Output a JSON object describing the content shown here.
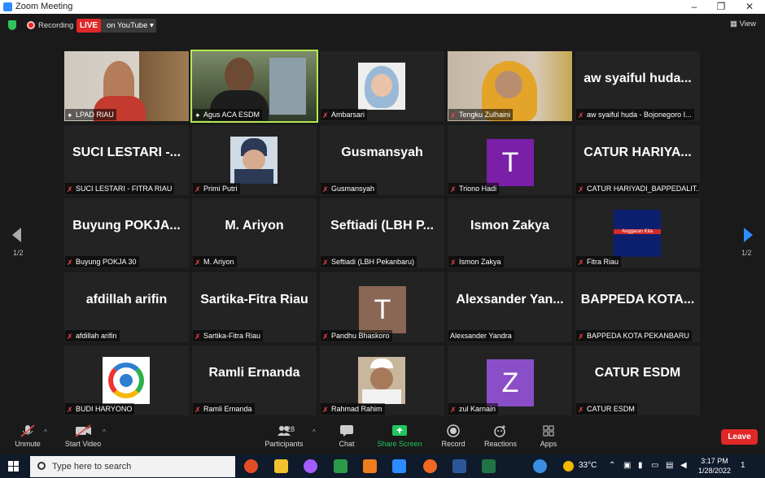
{
  "window": {
    "title": "Zoom Meeting"
  },
  "topbar": {
    "recording_label": "Recording",
    "live_label": "LIVE",
    "stream_label": "on YouTube ▾",
    "view_label": "View"
  },
  "pagination": {
    "left": "1/2",
    "right": "1/2"
  },
  "participants": [
    {
      "id": "lpad",
      "name": "LPAD RIAU",
      "muted": false,
      "kind": "photo",
      "active": false
    },
    {
      "id": "agus",
      "name": "Agus ACA ESDM",
      "muted": false,
      "kind": "photo",
      "active": true
    },
    {
      "id": "ambarsari",
      "name": "Ambarsari",
      "muted": true,
      "kind": "photo",
      "active": false
    },
    {
      "id": "tengku",
      "name": "Tengku Zulhaini",
      "muted": true,
      "kind": "photo",
      "active": false
    },
    {
      "id": "aw",
      "name": "aw syaiful huda - Bojonegoro I...",
      "display": "aw syaiful huda...",
      "muted": true,
      "kind": "text"
    },
    {
      "id": "suci",
      "name": "SUCI LESTARI - FITRA RIAU",
      "display": "SUCI LESTARI -...",
      "muted": true,
      "kind": "text"
    },
    {
      "id": "primi",
      "name": "Primi Putri",
      "muted": true,
      "kind": "photo"
    },
    {
      "id": "gusmansyah",
      "name": "Gusmansyah",
      "display": "Gusmansyah",
      "muted": true,
      "kind": "text"
    },
    {
      "id": "triono",
      "name": "Triono Hadi",
      "muted": true,
      "kind": "avatar",
      "letter": "T",
      "color": "#7a1fa8"
    },
    {
      "id": "catur1",
      "name": "CATUR HARIYADI_BAPPEDALIT...",
      "display": "CATUR HARIYA...",
      "muted": true,
      "kind": "text"
    },
    {
      "id": "buyung",
      "name": "Buyung POKJA 30",
      "display": "Buyung POKJA...",
      "muted": true,
      "kind": "text"
    },
    {
      "id": "ariyon",
      "name": "M. Ariyon",
      "display": "M. Ariyon",
      "muted": true,
      "kind": "text"
    },
    {
      "id": "seftiadi",
      "name": "Seftiadi (LBH Pekanbaru)",
      "display": "Seftiadi (LBH P...",
      "muted": true,
      "kind": "text"
    },
    {
      "id": "ismon",
      "name": "Ismon Zakya",
      "display": "Ismon Zakya",
      "muted": true,
      "kind": "text"
    },
    {
      "id": "fitra",
      "name": "Fitra Riau",
      "muted": true,
      "kind": "logo",
      "logo_text": "Anggaran Kita"
    },
    {
      "id": "afdillah",
      "name": "afdillah arifin",
      "display": "afdillah arifin",
      "muted": true,
      "kind": "text"
    },
    {
      "id": "sartika",
      "name": "Sartika-Fitra Riau",
      "display": "Sartika-Fitra Riau",
      "muted": true,
      "kind": "text"
    },
    {
      "id": "pandhu",
      "name": "Pandhu Bhaskoro",
      "muted": true,
      "kind": "avatar",
      "letter": "T",
      "color": "#8a6655"
    },
    {
      "id": "alexsander",
      "name": "Alexsander Yandra",
      "display": "Alexsander Yan...",
      "muted": false,
      "kind": "text"
    },
    {
      "id": "bappeda",
      "name": "BAPPEDA KOTA PEKANBARU",
      "display": "BAPPEDA KOTA...",
      "muted": true,
      "kind": "text"
    },
    {
      "id": "budi",
      "name": "BUDI HARYONO",
      "muted": true,
      "kind": "logo2"
    },
    {
      "id": "ramli",
      "name": "Ramli Ernanda",
      "display": "Ramli Ernanda",
      "muted": true,
      "kind": "text"
    },
    {
      "id": "rahmad",
      "name": "Rahmad Rahim",
      "muted": true,
      "kind": "photo"
    },
    {
      "id": "zul",
      "name": "zul Karnain",
      "muted": true,
      "kind": "avatar",
      "letter": "Z",
      "color": "#8a4fc8"
    },
    {
      "id": "catur2",
      "name": "CATUR ESDM",
      "display": "CATUR ESDM",
      "muted": true,
      "kind": "text"
    }
  ],
  "toolbar": {
    "unmute": "Unmute",
    "start_video": "Start Video",
    "participants": "Participants",
    "participant_count": "28",
    "chat": "Chat",
    "share": "Share Screen",
    "record": "Record",
    "reactions": "Reactions",
    "apps": "Apps",
    "leave": "Leave"
  },
  "taskbar": {
    "search_placeholder": "Type here to search",
    "temperature": "33°C",
    "time": "3:17 PM",
    "date": "1/28/2022",
    "notif_count": "1"
  },
  "colors": {
    "live": "#e02828",
    "share": "#22c55e",
    "active_speaker": "#b5e851",
    "nav_right": "#2d8cff",
    "taskbar": "#0f1a2b"
  }
}
